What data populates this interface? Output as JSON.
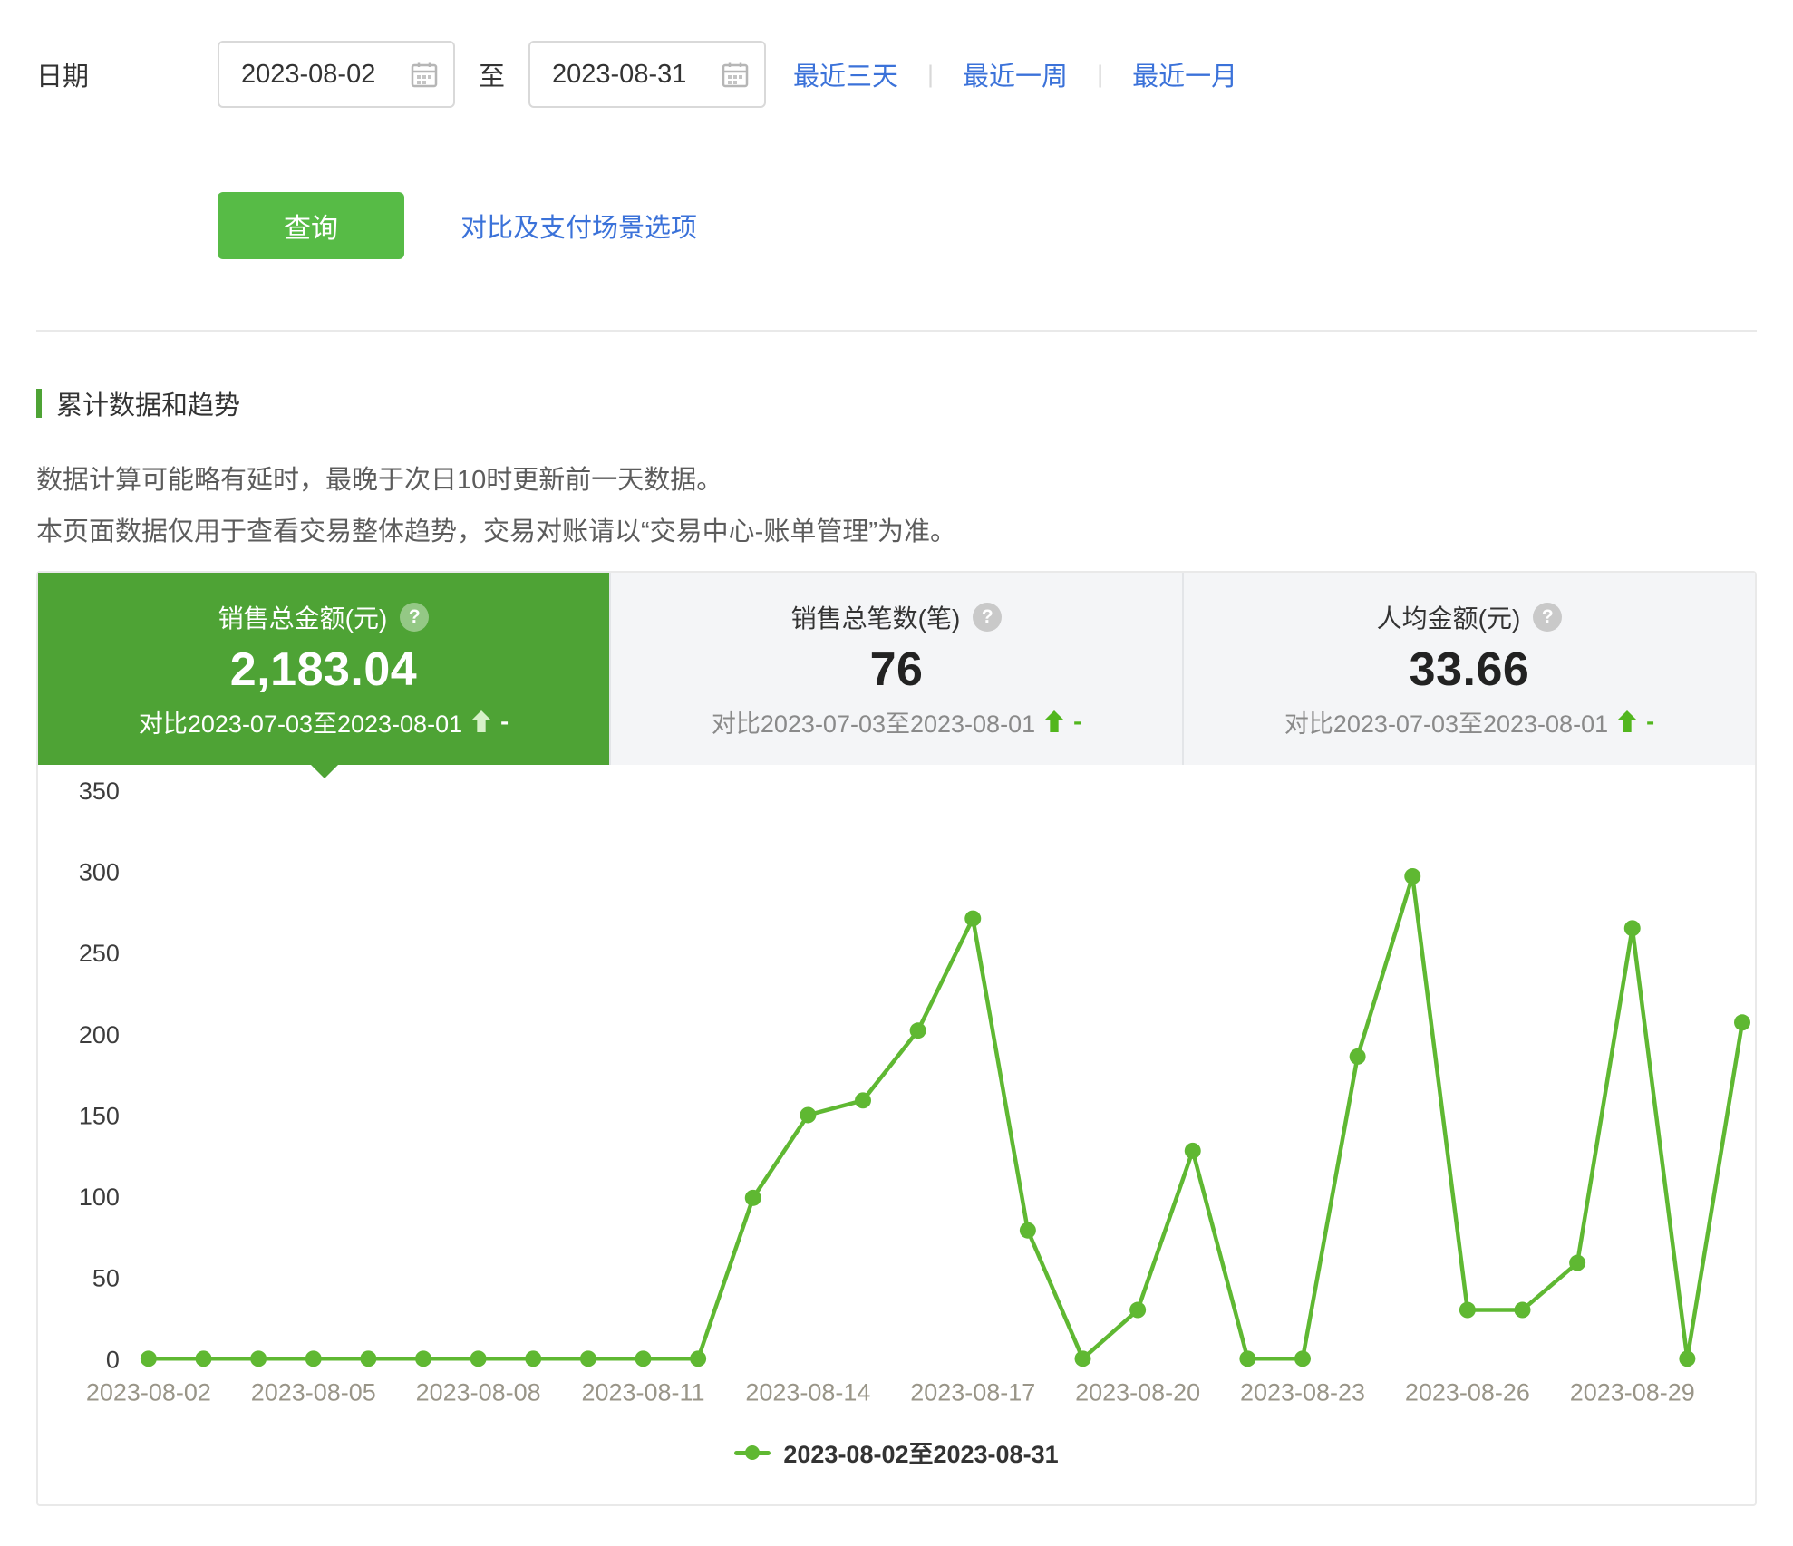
{
  "colors": {
    "accent_blue": "#3B72D9",
    "button_green": "#57BB46",
    "card_green": "#4EA335",
    "line_green": "#5FB832",
    "delta_green": "#52B61E"
  },
  "filters": {
    "date_label": "日期",
    "start_date": "2023-08-02",
    "to_label": "至",
    "end_date": "2023-08-31",
    "separator": "|",
    "quick_ranges": [
      "最近三天",
      "最近一周",
      "最近一月"
    ]
  },
  "actions": {
    "query_label": "查询",
    "options_label": "对比及支付场景选项"
  },
  "section": {
    "title": "累计数据和趋势",
    "notes": [
      "数据计算可能略有延时，最晚于次日10时更新前一天数据。",
      "本页面数据仅用于查看交易整体趋势，交易对账请以“交易中心-账单管理”为准。"
    ]
  },
  "icons": {
    "help": "?",
    "calendar": "calendar-grid",
    "trend_up": "up-arrow"
  },
  "stats": [
    {
      "title": "销售总金额(元)",
      "value": "2,183.04",
      "compare": "对比2023-07-03至2023-08-01",
      "delta": "-"
    },
    {
      "title": "销售总笔数(笔)",
      "value": "76",
      "compare": "对比2023-07-03至2023-08-01",
      "delta": "-"
    },
    {
      "title": "人均金额(元)",
      "value": "33.66",
      "compare": "对比2023-07-03至2023-08-01",
      "delta": "-"
    }
  ],
  "chart_data": {
    "type": "line",
    "title": "",
    "xlabel": "",
    "ylabel": "",
    "x": [
      "2023-08-02",
      "2023-08-03",
      "2023-08-04",
      "2023-08-05",
      "2023-08-06",
      "2023-08-07",
      "2023-08-08",
      "2023-08-09",
      "2023-08-10",
      "2023-08-11",
      "2023-08-12",
      "2023-08-13",
      "2023-08-14",
      "2023-08-15",
      "2023-08-16",
      "2023-08-17",
      "2023-08-18",
      "2023-08-19",
      "2023-08-20",
      "2023-08-21",
      "2023-08-22",
      "2023-08-23",
      "2023-08-24",
      "2023-08-25",
      "2023-08-26",
      "2023-08-27",
      "2023-08-28",
      "2023-08-29",
      "2023-08-30",
      "2023-08-31"
    ],
    "series": [
      {
        "name": "2023-08-02至2023-08-31",
        "values": [
          0,
          0,
          0,
          0,
          0,
          0,
          0,
          0,
          0,
          0,
          0,
          99,
          150,
          159,
          202,
          271,
          79,
          0,
          30,
          128,
          0,
          0,
          186,
          297,
          30,
          30,
          59,
          265,
          0,
          207
        ]
      }
    ],
    "ylim": [
      0,
      350
    ],
    "yticks": [
      0,
      50,
      100,
      150,
      200,
      250,
      300,
      350
    ],
    "xtick_every": 3,
    "grid": false,
    "legend": "2023-08-02至2023-08-31",
    "legend_position": "bottom"
  }
}
